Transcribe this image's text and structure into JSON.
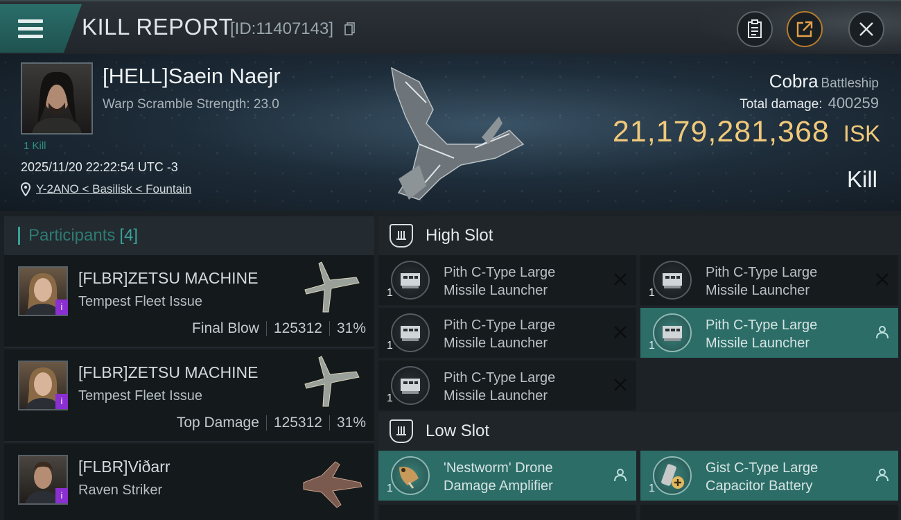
{
  "header": {
    "title": "KILL REPORT",
    "report_id": "[ID:11407143]"
  },
  "victim": {
    "name": "[HELL]Saein Naejr",
    "warp_scramble": "Warp Scramble Strength: 23.0",
    "kills": "1 Kill",
    "datetime": "2025/11/20 22:22:54 UTC -3",
    "location": "Y-2ANO < Basilisk < Fountain"
  },
  "ship": {
    "name": "Cobra",
    "class": "Battleship",
    "total_damage_label": "Total damage:",
    "total_damage": "400259",
    "isk_value": "21,179,281,368",
    "isk_unit": "ISK",
    "result": "Kill"
  },
  "participants": {
    "label": "Participants",
    "count": "[4]",
    "rows": [
      {
        "name": "[FLBR]ZETSU MACHINE",
        "ship": "Tempest Fleet Issue",
        "role": "Final Blow",
        "damage": "125312",
        "percent": "31%"
      },
      {
        "name": "[FLBR]ZETSU MACHINE",
        "ship": "Tempest Fleet Issue",
        "role": "Top Damage",
        "damage": "125312",
        "percent": "31%"
      },
      {
        "name": "[FLBR]Viðarr",
        "ship": "Raven Striker",
        "role": "",
        "damage": "",
        "percent": ""
      }
    ]
  },
  "high_slot": {
    "title": "High Slot",
    "items": [
      {
        "line1": "Pith C-Type Large",
        "line2": "Missile Launcher",
        "qty": "1",
        "status": "destroyed"
      },
      {
        "line1": "Pith C-Type Large",
        "line2": "Missile Launcher",
        "qty": "1",
        "status": "destroyed"
      },
      {
        "line1": "Pith C-Type Large",
        "line2": "Missile Launcher",
        "qty": "1",
        "status": "destroyed"
      },
      {
        "line1": "Pith C-Type Large",
        "line2": "Missile Launcher",
        "qty": "1",
        "status": "dropped"
      },
      {
        "line1": "Pith C-Type Large",
        "line2": "Missile Launcher",
        "qty": "1",
        "status": "destroyed"
      }
    ]
  },
  "low_slot": {
    "title": "Low Slot",
    "items": [
      {
        "line1": "'Nestworm' Drone",
        "line2": "Damage Amplifier",
        "qty": "1",
        "status": "dropped"
      },
      {
        "line1": "Gist C-Type Large",
        "line2": "Capacitor Battery",
        "qty": "1",
        "status": "dropped"
      }
    ]
  },
  "colors": {
    "accent": "#2c6d68",
    "isk": "#f0c97a",
    "menu": "#2a6e6a"
  }
}
